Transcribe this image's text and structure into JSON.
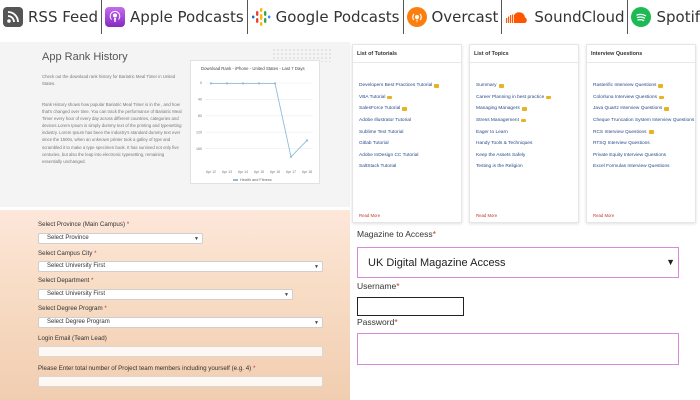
{
  "podcasts": [
    {
      "label": "RSS Feed",
      "icon": "rss-icon",
      "color": "#555555"
    },
    {
      "label": "Apple Podcasts",
      "icon": "apple-podcasts-icon",
      "color": "#9b3fd6"
    },
    {
      "label": "Google Podcasts",
      "icon": "google-podcasts-icon",
      "color": "#4285f4"
    },
    {
      "label": "Overcast",
      "icon": "overcast-icon",
      "color": "#fc7e0f"
    },
    {
      "label": "SoundCloud",
      "icon": "soundcloud-icon",
      "color": "#ff5500"
    },
    {
      "label": "Spotify",
      "icon": "spotify-icon",
      "color": "#1db954"
    }
  ],
  "rank": {
    "title": "App Rank History",
    "intro": "Check out the download rank history for Bariatric Meal Timer in United States.",
    "body": "Rank History shows how popular Bariatric Meal Timer is in the , and how that's changed over time. You can track the performance of Bariatric Meal Timer every hour of every day across different countries, categories and devices.Lorem Ipsum is simply dummy text of the printing and typesetting industry. Lorem Ipsum has been the industry's standard dummy text ever since the 1500s, when an unknown printer took a galley of type and scrambled it to make a type specimen book. It has survived not only five centuries, but also the leap into electronic typesetting, remaining essentially unchanged."
  },
  "chart_data": {
    "type": "line",
    "title": "Download Rank - iPhone - United States - Last 7 Days",
    "categories": [
      "Apr 12",
      "Apr 13",
      "Apr 14",
      "Apr 15",
      "Apr 16",
      "Apr 17",
      "Apr 18"
    ],
    "series": [
      {
        "name": "Health and Fitness",
        "values": [
          1,
          1,
          1,
          1,
          1,
          180,
          140
        ]
      }
    ],
    "y_ticks": [
      "0",
      "40",
      "80",
      "120",
      "160"
    ],
    "ylim": [
      0,
      200
    ],
    "y_inverted": true,
    "line_color": "#8fbcd8",
    "legend_position": "bottom"
  },
  "cards": [
    {
      "title": "List of Tutorials",
      "items": [
        {
          "label": "Developers Best Practices Tutorial",
          "star": true
        },
        {
          "label": "VBA Tutorial",
          "star": true
        },
        {
          "label": "SalesForce Tutorial",
          "star": true
        },
        {
          "label": "Adobe Illustrator Tutorial",
          "star": false
        },
        {
          "label": "Sublime Text Tutorial",
          "star": false
        },
        {
          "label": "Gitlab Tutorial",
          "star": false
        },
        {
          "label": "Adobe InDesign CC Tutorial",
          "star": false
        },
        {
          "label": "SaltStack Tutorial",
          "star": false
        }
      ],
      "read_more": "Read More"
    },
    {
      "title": "List of Topics",
      "items": [
        {
          "label": "Summary",
          "star": true
        },
        {
          "label": "Career Planning in best practice",
          "star": true
        },
        {
          "label": "Managing Managers",
          "star": true
        },
        {
          "label": "Stress Management",
          "star": true
        },
        {
          "label": "Eager to Learn",
          "star": false
        },
        {
          "label": "Handy Tools & Techniques",
          "star": false
        },
        {
          "label": "Keep the Assets Safely",
          "star": false
        },
        {
          "label": "Testing is the Religion",
          "star": false
        }
      ],
      "read_more": "Read More"
    },
    {
      "title": "Interview Questions",
      "items": [
        {
          "label": "Rasterific Interview Questions",
          "star": true
        },
        {
          "label": "Colorluna Interview Questions",
          "star": true
        },
        {
          "label": "Java Quartz Interview Questions",
          "star": true
        },
        {
          "label": "Cheque Truncation System Interview Questions",
          "star": true
        },
        {
          "label": "RCS Interview Questions",
          "star": true
        },
        {
          "label": "RTSQ Interview Questions",
          "star": false
        },
        {
          "label": "Private Equity Interview Questions",
          "star": false
        },
        {
          "label": "Excel Formulas Interview Questions",
          "star": false
        }
      ],
      "read_more": "Read More"
    }
  ],
  "form": {
    "province_label": "Select Province (Main Campus)",
    "province_value": "Select Province",
    "city_label": "Select Campus City",
    "city_value": "Select University First",
    "department_label": "Select Department",
    "department_value": "Select University First",
    "degree_label": "Select Degree Program",
    "degree_value": "Select Degree Program",
    "login_label": "Login Email (Team Lead)",
    "members_label": "Please Enter total number of Project team members including yourself (e.g. 4)",
    "required_mark": "*"
  },
  "login": {
    "magazine_label": "Magazine to Access",
    "magazine_value": "UK Digital Magazine Access",
    "username_label": "Username",
    "password_label": "Password",
    "required_mark": "*",
    "focus_color": "#d58bd8"
  }
}
